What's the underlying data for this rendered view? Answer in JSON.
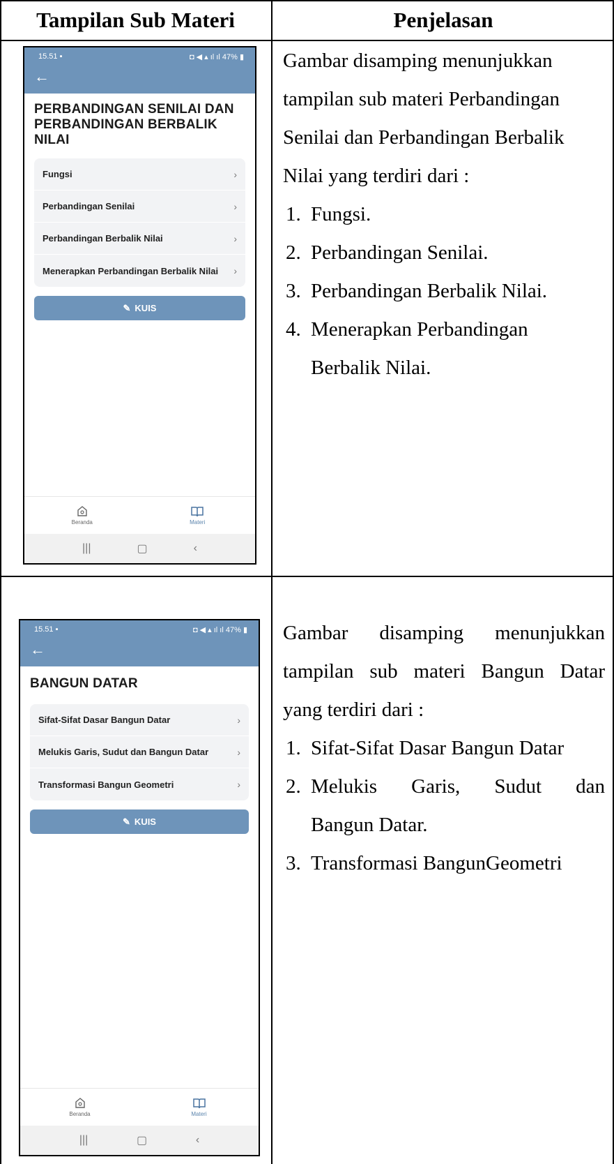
{
  "header": {
    "col1": "Tampilan Sub Materi",
    "col2": "Penjelasan"
  },
  "rows": [
    {
      "phone": {
        "time": "15.51",
        "status_right": "47%",
        "title_line1": "PERBANDINGAN SENILAI DAN",
        "title_line2": "PERBANDINGAN BERBALIK NILAI",
        "items": [
          "Fungsi",
          "Perbandingan Senilai",
          "Perbandingan Berbalik Nilai",
          "Menerapkan Perbandingan Berbalik Nilai"
        ],
        "kuis": "KUIS",
        "nav_home": "Beranda",
        "nav_materi": "Materi"
      },
      "desc": {
        "intro": [
          "Gambar disamping menunjukkan",
          "tampilan sub materi Perbandingan",
          "Senilai dan Perbandingan Berbalik",
          "Nilai yang terdiri dari :"
        ],
        "list": [
          "1.",
          "Fungsi.",
          "2.",
          "Perbandingan Senilai.",
          "3.",
          "Perbandingan Berbalik Nilai.",
          "4.",
          "Menerapkan Perbandingan",
          "Berbalik Nilai."
        ]
      }
    },
    {
      "phone": {
        "time": "15.51",
        "status_right": "47%",
        "title": "BANGUN DATAR",
        "items": [
          "Sifat-Sifat Dasar Bangun Datar",
          "Melukis Garis, Sudut dan Bangun Datar",
          "Transformasi Bangun Geometri"
        ],
        "kuis": "KUIS",
        "nav_home": "Beranda",
        "nav_materi": "Materi"
      },
      "desc": {
        "intro": [
          "Gambar disamping menunjukkan",
          "tampilan sub materi Bangun Datar",
          "yang terdiri dari :"
        ],
        "list": [
          "1.",
          "Sifat-Sifat Dasar Bangun Datar",
          "2.",
          "Melukis Garis, Sudut dan",
          "Bangun Datar.",
          "3.",
          "Transformasi BangunGeometri"
        ]
      }
    }
  ]
}
